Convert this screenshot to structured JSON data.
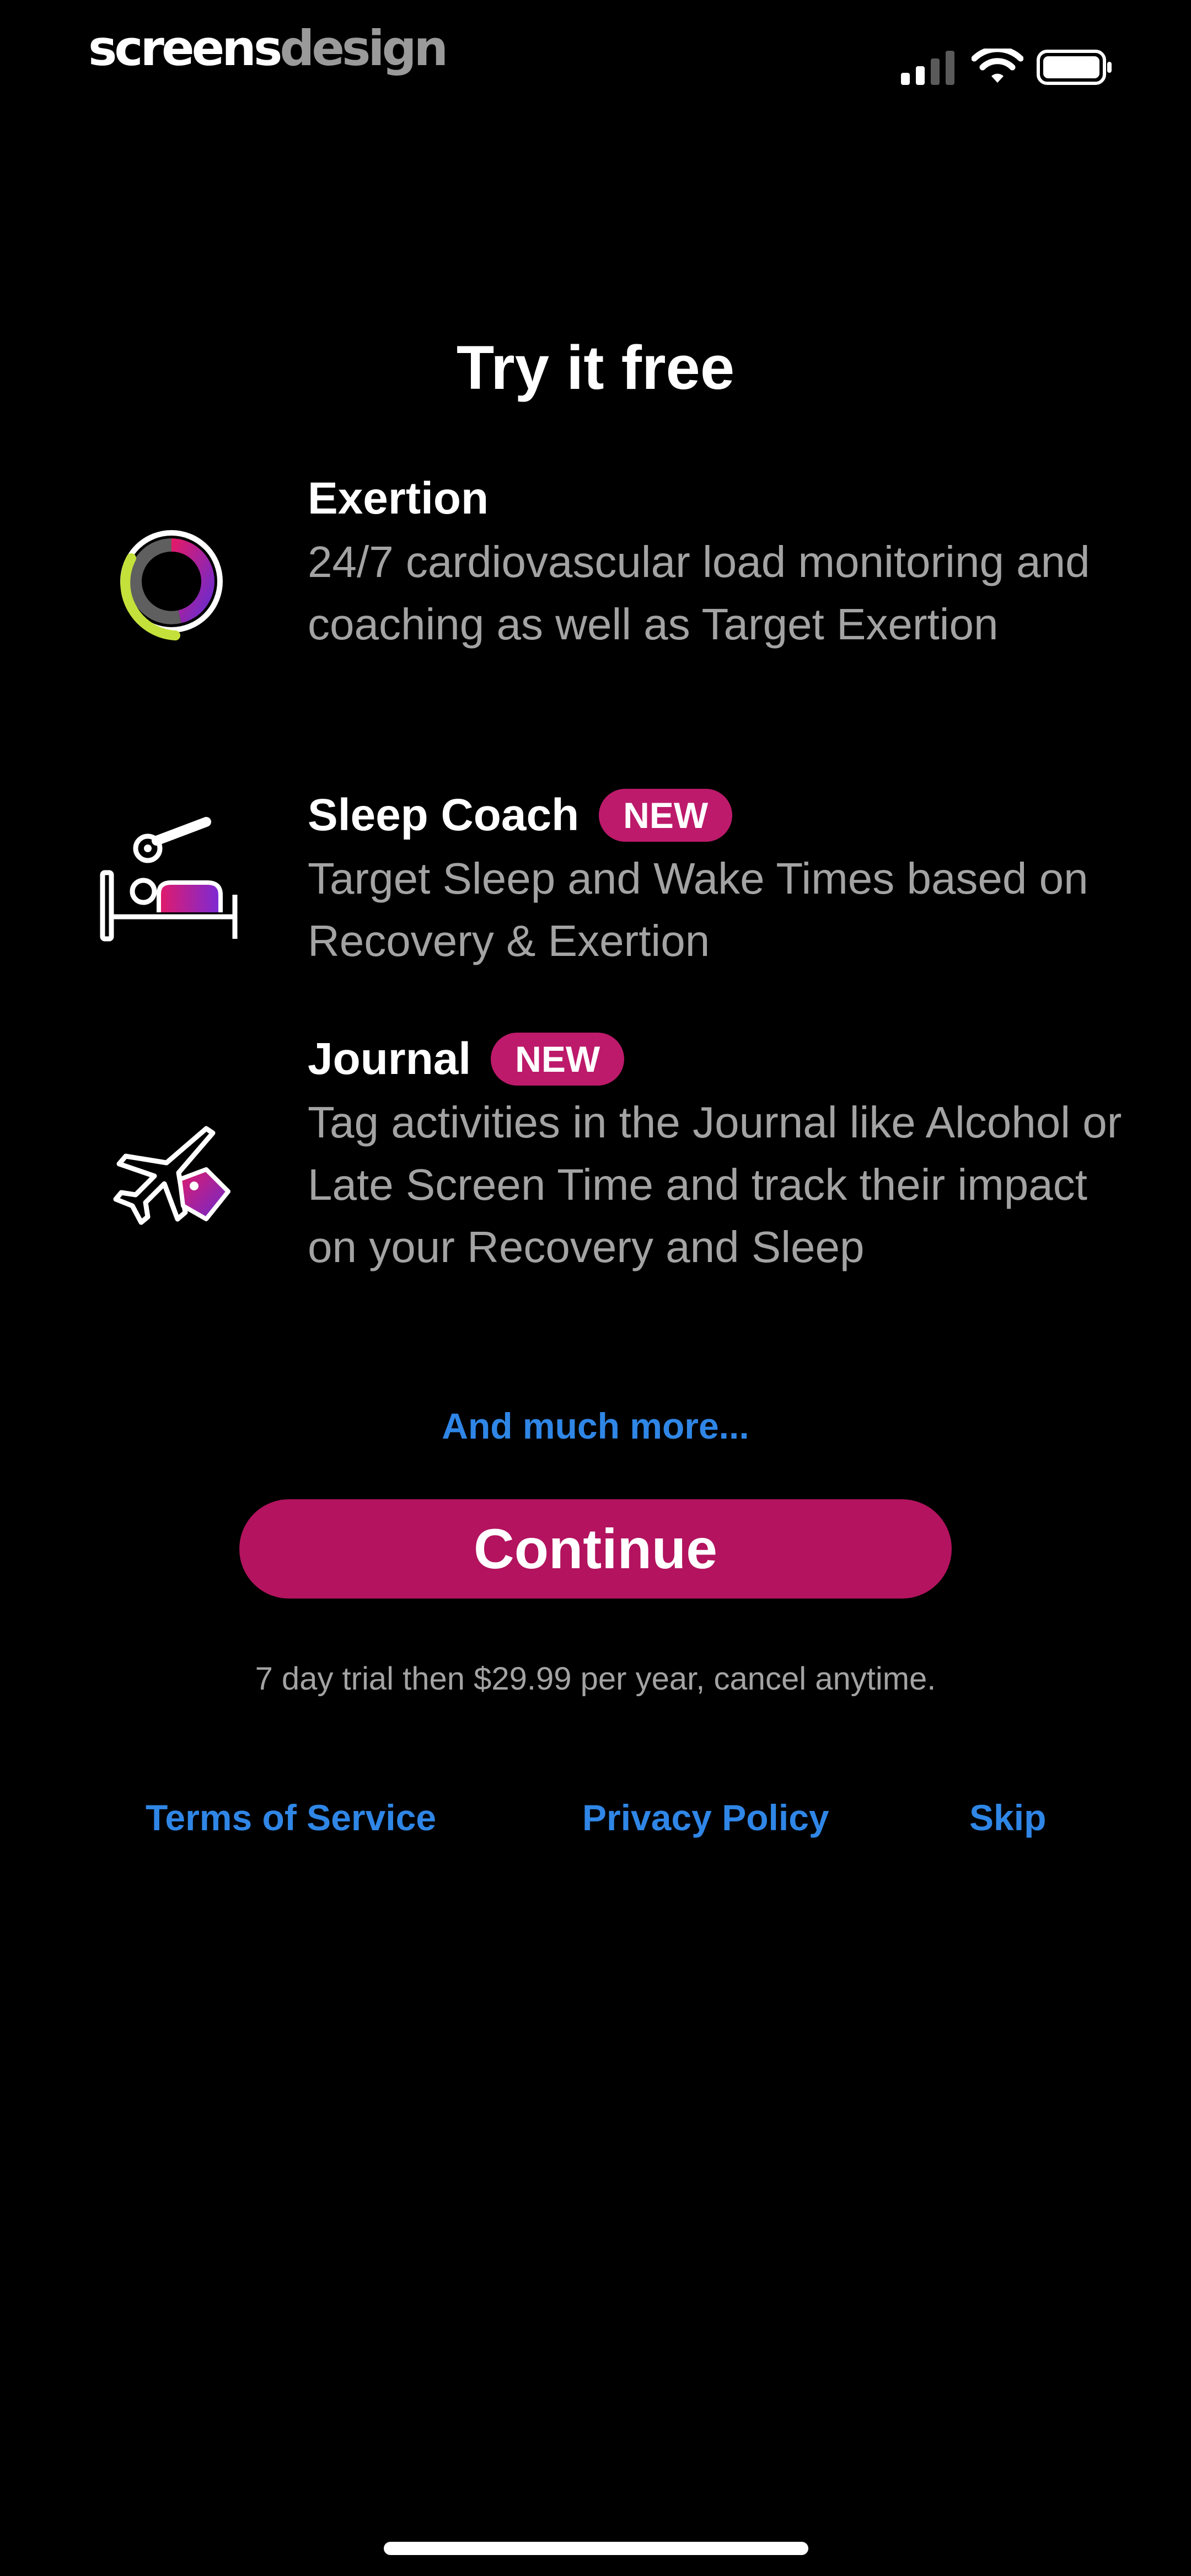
{
  "watermark": {
    "part1": "screens",
    "part2": "design"
  },
  "status_bar": {
    "signal": "signal-icon",
    "wifi": "wifi-icon",
    "battery": "battery-icon"
  },
  "title": "Try it free",
  "features": [
    {
      "icon": "exertion-ring-icon",
      "title": "Exertion",
      "badge": "",
      "description": "24/7 cardiovascular load monitoring and coaching as well as Target Exertion"
    },
    {
      "icon": "sleep-bed-icon",
      "title": "Sleep Coach",
      "badge": "NEW",
      "description": "Target Sleep and Wake Times based on Recovery & Exertion"
    },
    {
      "icon": "journal-plane-tag-icon",
      "title": "Journal",
      "badge": "NEW",
      "description": "Tag activities in the Journal like Alcohol or Late Screen Time and track their impact on your Recovery and Sleep"
    }
  ],
  "more_link": "And much more...",
  "continue_label": "Continue",
  "trial_text": "7 day trial then $29.99 per year, cancel anytime.",
  "footer": {
    "terms": "Terms of Service",
    "privacy": "Privacy Policy",
    "skip": "Skip"
  },
  "colors": {
    "background": "#000000",
    "accent": "#b3135f",
    "badge": "#bd1a6b",
    "link": "#2f86e6",
    "secondary_text": "#a3a3a3"
  }
}
